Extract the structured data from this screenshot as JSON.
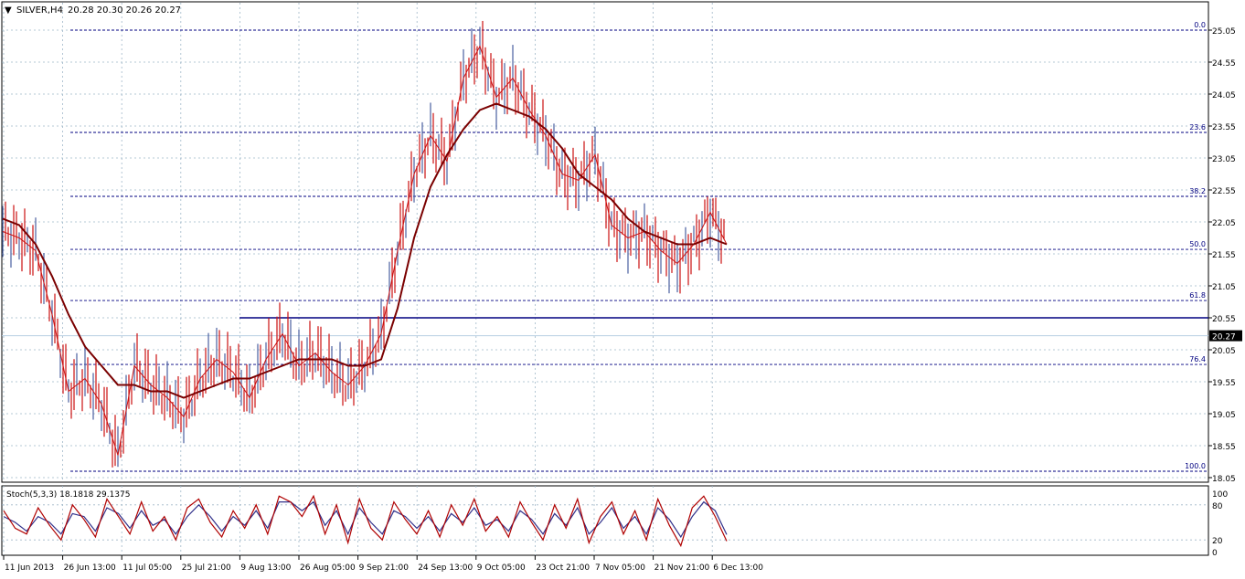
{
  "header": {
    "menu_glyph": "▼",
    "symbol_label": "SILVER,H4",
    "ohlc_text": "20.28 20.30 20.26 20.27"
  },
  "colors": {
    "background": "#ffffff",
    "grid": "#9fb7c8",
    "candle": "#cc1111",
    "candle_alt": "#4a5fa0",
    "moving_average": "#7a0000",
    "fib_line": "#000080",
    "resistance_line": "#000080",
    "current_price_line": "#b7cfe2",
    "stoch_main": "#b00000",
    "stoch_signal": "#30308a"
  },
  "chart_data": [
    {
      "type": "line",
      "title": "SILVER,H4",
      "price_series_description": "candlesticks (approximate closing path)",
      "ylim": [
        18.05,
        25.05
      ],
      "y_ticks": [
        "25.05",
        "24.55",
        "24.05",
        "23.55",
        "23.05",
        "22.55",
        "22.05",
        "21.55",
        "21.05",
        "20.55",
        "20.05",
        "19.55",
        "19.05",
        "18.55",
        "18.05"
      ],
      "current_price": "20.27",
      "x_ticks": [
        "11 Jun 2013",
        "26 Jun 13:00",
        "11 Jul 05:00",
        "25 Jul 21:00",
        "9 Aug 13:00",
        "26 Aug 05:00",
        "9 Sep 21:00",
        "24 Sep 13:00",
        "9 Oct 05:00",
        "23 Oct 21:00",
        "7 Nov 05:00",
        "21 Nov 21:00",
        "6 Dec 13:00"
      ],
      "x": [
        0,
        3,
        6,
        9,
        12,
        15,
        18,
        21,
        24,
        27,
        30,
        33,
        36,
        39,
        42,
        45,
        48,
        51,
        54,
        57,
        60,
        63,
        66,
        69,
        72,
        75,
        78,
        81,
        84,
        87,
        90,
        93,
        96,
        99,
        102,
        105,
        108,
        111,
        114,
        117,
        120,
        123,
        126,
        129,
        132
      ],
      "series": [
        {
          "values": [
            21.9,
            21.8,
            21.6,
            20.6,
            19.4,
            19.6,
            19.2,
            18.4,
            19.8,
            19.5,
            19.3,
            19.0,
            19.6,
            19.9,
            19.7,
            19.3,
            19.9,
            20.3,
            19.8,
            20.0,
            19.7,
            19.5,
            19.8,
            20.3,
            21.6,
            22.8,
            23.4,
            23.0,
            24.3,
            24.8,
            24.0,
            24.3,
            23.8,
            23.4,
            22.8,
            22.7,
            23.1,
            22.0,
            21.8,
            21.9,
            21.6,
            21.4,
            21.7,
            22.2,
            21.7
          ]
        },
        {
          "values": [
            22.1,
            22.0,
            21.7,
            21.2,
            20.6,
            20.1,
            19.8,
            19.5,
            19.5,
            19.4,
            19.4,
            19.3,
            19.4,
            19.5,
            19.6,
            19.6,
            19.7,
            19.8,
            19.9,
            19.9,
            19.9,
            19.8,
            19.8,
            19.9,
            20.7,
            21.8,
            22.6,
            23.1,
            23.5,
            23.8,
            23.9,
            23.8,
            23.7,
            23.5,
            23.2,
            22.8,
            22.6,
            22.4,
            22.1,
            21.9,
            21.8,
            21.7,
            21.7,
            21.8,
            21.7
          ]
        }
      ],
      "fib_levels": [
        {
          "label": "0.0",
          "price": 25.05
        },
        {
          "label": "23.6",
          "price": 23.45
        },
        {
          "label": "38.2",
          "price": 22.45
        },
        {
          "label": "50.0",
          "price": 21.62
        },
        {
          "label": "61.8",
          "price": 20.82
        },
        {
          "label": "76.4",
          "price": 19.82
        },
        {
          "label": "100.0",
          "price": 18.15
        }
      ],
      "horizontal_line": 20.55
    },
    {
      "type": "line",
      "title": "Stoch(5,3,3) 18.1818 29.1375",
      "ylim": [
        0,
        100
      ],
      "y_ticks": [
        "100",
        "80",
        "20",
        "0"
      ],
      "series": [
        {
          "values": [
            70,
            40,
            30,
            75,
            45,
            20,
            80,
            55,
            25,
            90,
            60,
            30,
            85,
            35,
            60,
            20,
            75,
            90,
            50,
            25,
            70,
            40,
            80,
            30,
            95,
            85,
            60,
            95,
            30,
            80,
            15,
            90,
            40,
            20,
            85,
            55,
            30,
            70,
            25,
            80,
            45,
            90,
            35,
            60,
            25,
            85,
            50,
            20,
            80,
            40,
            90,
            15,
            60,
            85,
            30,
            70,
            20,
            90,
            45,
            10,
            75,
            95,
            60,
            18
          ]
        },
        {
          "values": [
            60,
            50,
            35,
            60,
            50,
            30,
            65,
            60,
            35,
            75,
            65,
            40,
            70,
            45,
            55,
            30,
            60,
            80,
            60,
            35,
            60,
            45,
            70,
            40,
            85,
            85,
            70,
            85,
            45,
            70,
            30,
            75,
            50,
            30,
            70,
            60,
            40,
            60,
            35,
            65,
            50,
            75,
            45,
            55,
            35,
            70,
            55,
            30,
            65,
            45,
            75,
            30,
            50,
            75,
            40,
            60,
            30,
            75,
            55,
            25,
            60,
            85,
            70,
            29
          ]
        }
      ]
    }
  ]
}
